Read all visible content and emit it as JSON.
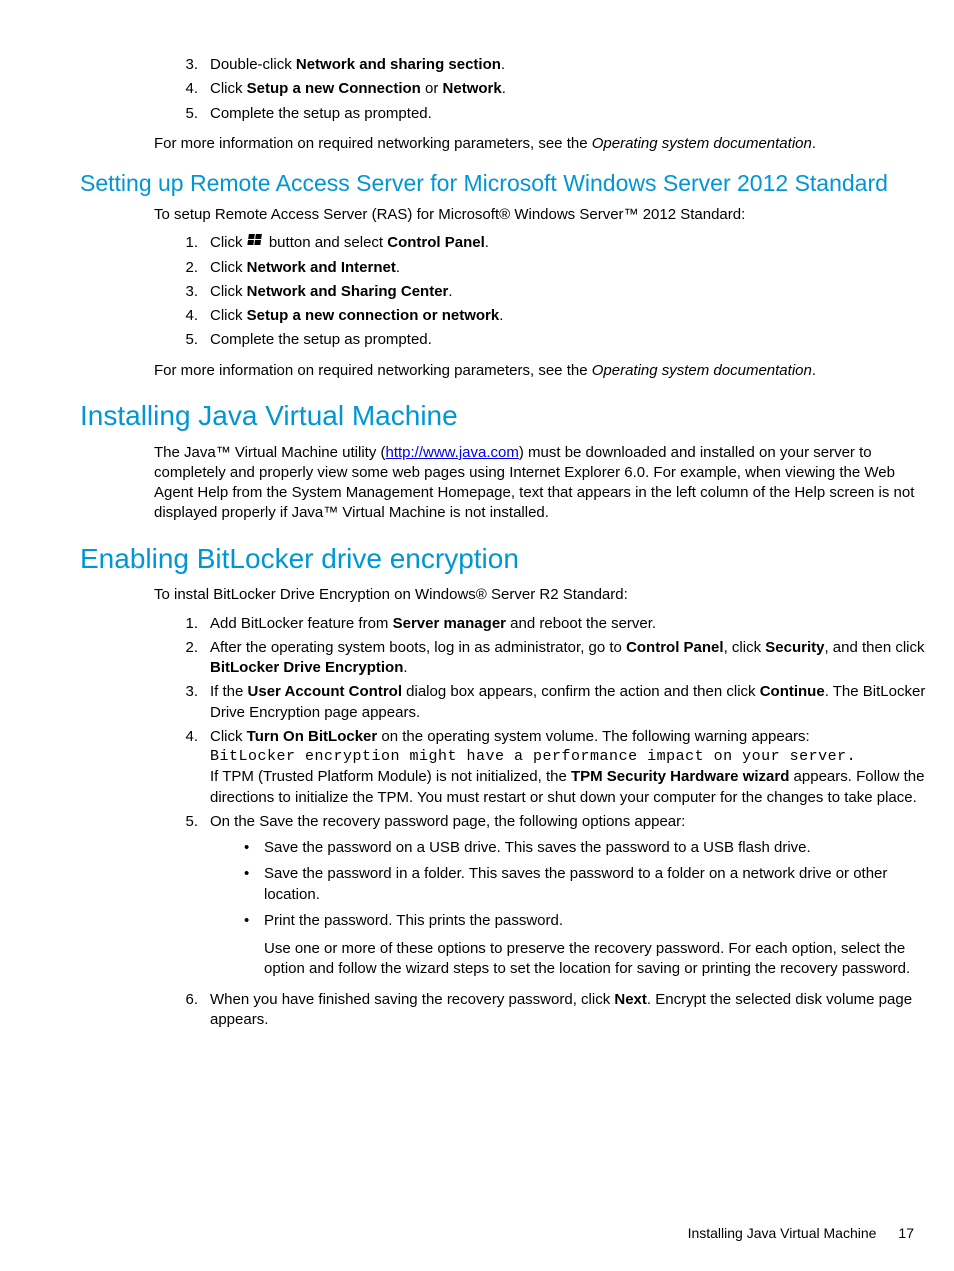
{
  "top_list": {
    "items": [
      {
        "num": "3.",
        "pre": "Double-click ",
        "b1": "Network and sharing section",
        "post": "."
      },
      {
        "num": "4.",
        "pre": "Click ",
        "b1": "Setup a new Connection",
        "mid": " or ",
        "b2": "Network",
        "post": "."
      },
      {
        "num": "5.",
        "pre": "Complete the setup as prompted.",
        "b1": "",
        "post": ""
      }
    ],
    "tail_pre": "For more information on required networking parameters, see the ",
    "tail_it": "Operating system documentation",
    "tail_post": "."
  },
  "ras": {
    "heading": "Setting up Remote Access Server for Microsoft Windows Server 2012 Standard",
    "intro": "To setup Remote Access Server (RAS) for Microsoft® Windows Server™ 2012 Standard:",
    "items": {
      "i1": {
        "num": "1.",
        "pre": "Click ",
        "mid": " button and select ",
        "b1": "Control Panel",
        "post": "."
      },
      "i2": {
        "num": "2.",
        "pre": "Click ",
        "b1": "Network and Internet",
        "post": "."
      },
      "i3": {
        "num": "3.",
        "pre": "Click ",
        "b1": "Network and Sharing Center",
        "post": "."
      },
      "i4": {
        "num": "4.",
        "pre": "Click ",
        "b1": "Setup a new connection or network",
        "post": "."
      },
      "i5": {
        "num": "5.",
        "pre": "Complete the setup as prompted."
      }
    },
    "tail_pre": "For more information on required networking parameters, see the ",
    "tail_it": "Operating system documentation",
    "tail_post": "."
  },
  "java": {
    "heading": "Installing Java Virtual Machine",
    "p_pre": "The Java™ Virtual Machine utility (",
    "link": "http://www.java.com",
    "p_post": ") must be downloaded and installed on your server to completely and properly view some web pages using Internet Explorer 6.0. For example, when viewing the Web Agent Help from the System Management Homepage, text that appears in the left column of the Help screen is not displayed properly if Java™ Virtual Machine is not installed."
  },
  "bitlocker": {
    "heading": "Enabling BitLocker drive encryption",
    "intro": "To instal BitLocker Drive Encryption on Windows® Server R2 Standard:",
    "i1": {
      "num": "1.",
      "pre": "Add BitLocker feature from ",
      "b1": "Server manager",
      "post": " and reboot the server."
    },
    "i2": {
      "num": "2.",
      "pre": "After the operating system boots, log in as administrator, go to ",
      "b1": "Control Panel",
      "mid1": ", click ",
      "b2": "Security",
      "mid2": ", and then click ",
      "b3": "BitLocker Drive Encryption",
      "post": "."
    },
    "i3": {
      "num": "3.",
      "pre": "If the ",
      "b1": "User Account Control",
      "mid": " dialog box appears, confirm the action and then click ",
      "b2": "Continue",
      "post": ". The BitLocker Drive Encryption page appears."
    },
    "i4": {
      "num": "4.",
      "pre": "Click ",
      "b1": "Turn On BitLocker",
      "post": " on the operating system volume. The following warning appears:",
      "code": "BitLocker encryption might have a performance impact on your server.",
      "line2_pre": "If TPM (Trusted Platform Module) is not initialized, the ",
      "line2_b": "TPM Security Hardware wizard",
      "line2_post": " appears. Follow the directions to initialize the TPM. You must restart or shut down your computer for the changes to take place."
    },
    "i5": {
      "num": "5.",
      "pre": "On the Save the recovery password page, the following options appear:",
      "b1": "Save the password on a USB drive. This saves the password to a USB flash drive.",
      "b2": "Save the password in a folder. This saves the password to a folder on a network drive or other location.",
      "b3": "Print the password. This prints the password.",
      "b3_para": "Use one or more of these options to preserve the recovery password. For each option, select the option and follow the wizard steps to set the location for saving or printing the recovery password."
    },
    "i6": {
      "num": "6.",
      "pre": "When you have finished saving the recovery password, click ",
      "b1": "Next",
      "post": ". Encrypt the selected disk volume page appears."
    }
  },
  "footer": {
    "title": "Installing Java Virtual Machine",
    "page": "17"
  }
}
